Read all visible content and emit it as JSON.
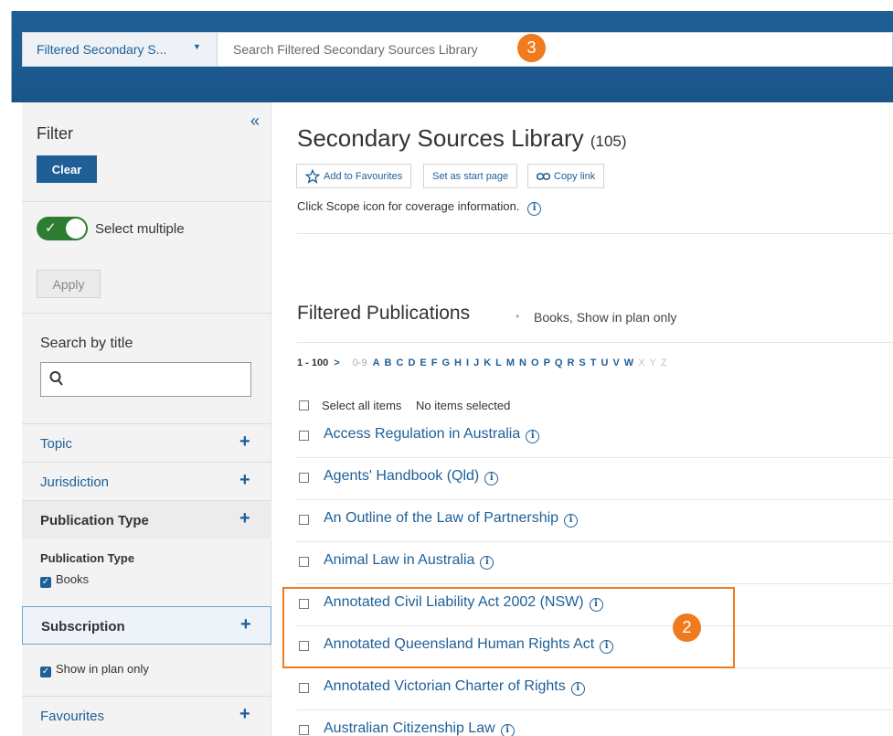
{
  "search": {
    "scope_label": "Filtered Secondary S...",
    "placeholder": "Search Filtered Secondary Sources Library"
  },
  "annotations": {
    "badge_top": "3",
    "badge_list": "2"
  },
  "sidebar": {
    "title": "Filter",
    "collapse_icon": "«",
    "clear_label": "Clear",
    "select_multiple_label": "Select multiple",
    "select_multiple_on": true,
    "apply_label": "Apply",
    "search_by_title_label": "Search by title",
    "facets": {
      "topic": "Topic",
      "jurisdiction": "Jurisdiction",
      "publication_type": "Publication Type",
      "subscription": "Subscription",
      "favourites": "Favourites"
    },
    "publication_type_sub": "Publication Type",
    "publication_type_value": "Books",
    "subscription_value": "Show in plan only"
  },
  "main": {
    "title": "Secondary Sources Library",
    "count": "(105)",
    "buttons": {
      "favourites": "Add to Favourites",
      "start_page": "Set as start page",
      "copy_link": "Copy link"
    },
    "scope_note": "Click Scope icon for coverage information.",
    "filtered_title": "Filtered Publications",
    "filter_summary": "Books, Show in plan only",
    "range": "1 - 100",
    "range_next": ">",
    "alpha_numeric": "0-9",
    "letters_enabled": [
      "A",
      "B",
      "C",
      "D",
      "E",
      "F",
      "G",
      "H",
      "I",
      "J",
      "K",
      "L",
      "M",
      "N",
      "O",
      "P",
      "Q",
      "R",
      "S",
      "T",
      "U",
      "V",
      "W"
    ],
    "letters_disabled": [
      "X",
      "Y",
      "Z"
    ],
    "select_all": "Select all items",
    "none_selected": "No items selected",
    "publications": [
      "Access Regulation in Australia",
      "Agents' Handbook (Qld)",
      "An Outline of the Law of Partnership",
      "Animal Law in Australia",
      "Annotated Civil Liability Act 2002 (NSW)",
      "Annotated Queensland Human Rights Act",
      "Annotated Victorian Charter of Rights",
      "Australian Citizenship Law"
    ]
  }
}
